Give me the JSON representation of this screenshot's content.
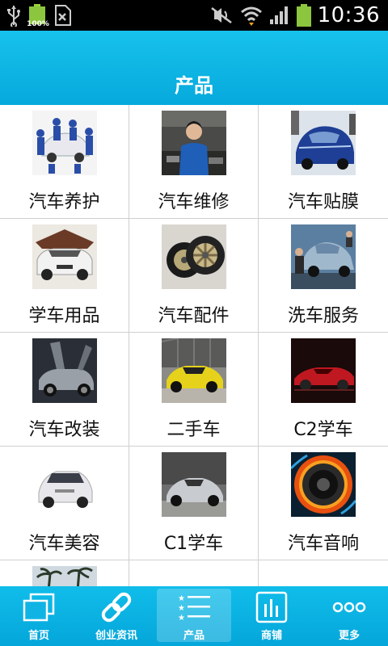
{
  "status_bar": {
    "battery_small_label": "100%",
    "time": "10:36"
  },
  "header": {
    "title": "产品"
  },
  "products": [
    {
      "label": "汽车养护",
      "icon": "car-maintenance-photo"
    },
    {
      "label": "汽车维修",
      "icon": "car-repair-photo"
    },
    {
      "label": "汽车贴膜",
      "icon": "car-film-photo"
    },
    {
      "label": "学车用品",
      "icon": "learner-supplies-photo"
    },
    {
      "label": "汽车配件",
      "icon": "car-parts-photo"
    },
    {
      "label": "洗车服务",
      "icon": "car-wash-photo"
    },
    {
      "label": "汽车改装",
      "icon": "car-modification-photo"
    },
    {
      "label": "二手车",
      "icon": "used-car-photo"
    },
    {
      "label": "C2学车",
      "icon": "c2-license-photo"
    },
    {
      "label": "汽车美容",
      "icon": "car-beauty-photo"
    },
    {
      "label": "C1学车",
      "icon": "c1-license-photo"
    },
    {
      "label": "汽车音响",
      "icon": "car-audio-photo"
    },
    {
      "label": "",
      "icon": "palm-trees-photo"
    }
  ],
  "bottom_nav": [
    {
      "label": "首页",
      "icon": "home-icon",
      "active": false
    },
    {
      "label": "创业资讯",
      "icon": "link-icon",
      "active": false
    },
    {
      "label": "产品",
      "icon": "list-icon",
      "active": true
    },
    {
      "label": "商铺",
      "icon": "chart-icon",
      "active": false
    },
    {
      "label": "更多",
      "icon": "more-icon",
      "active": false
    }
  ],
  "colors": {
    "header": "#0ab0e0",
    "status_bar": "#000000",
    "battery": "#8cc63f",
    "divider": "#d0d0d0"
  }
}
